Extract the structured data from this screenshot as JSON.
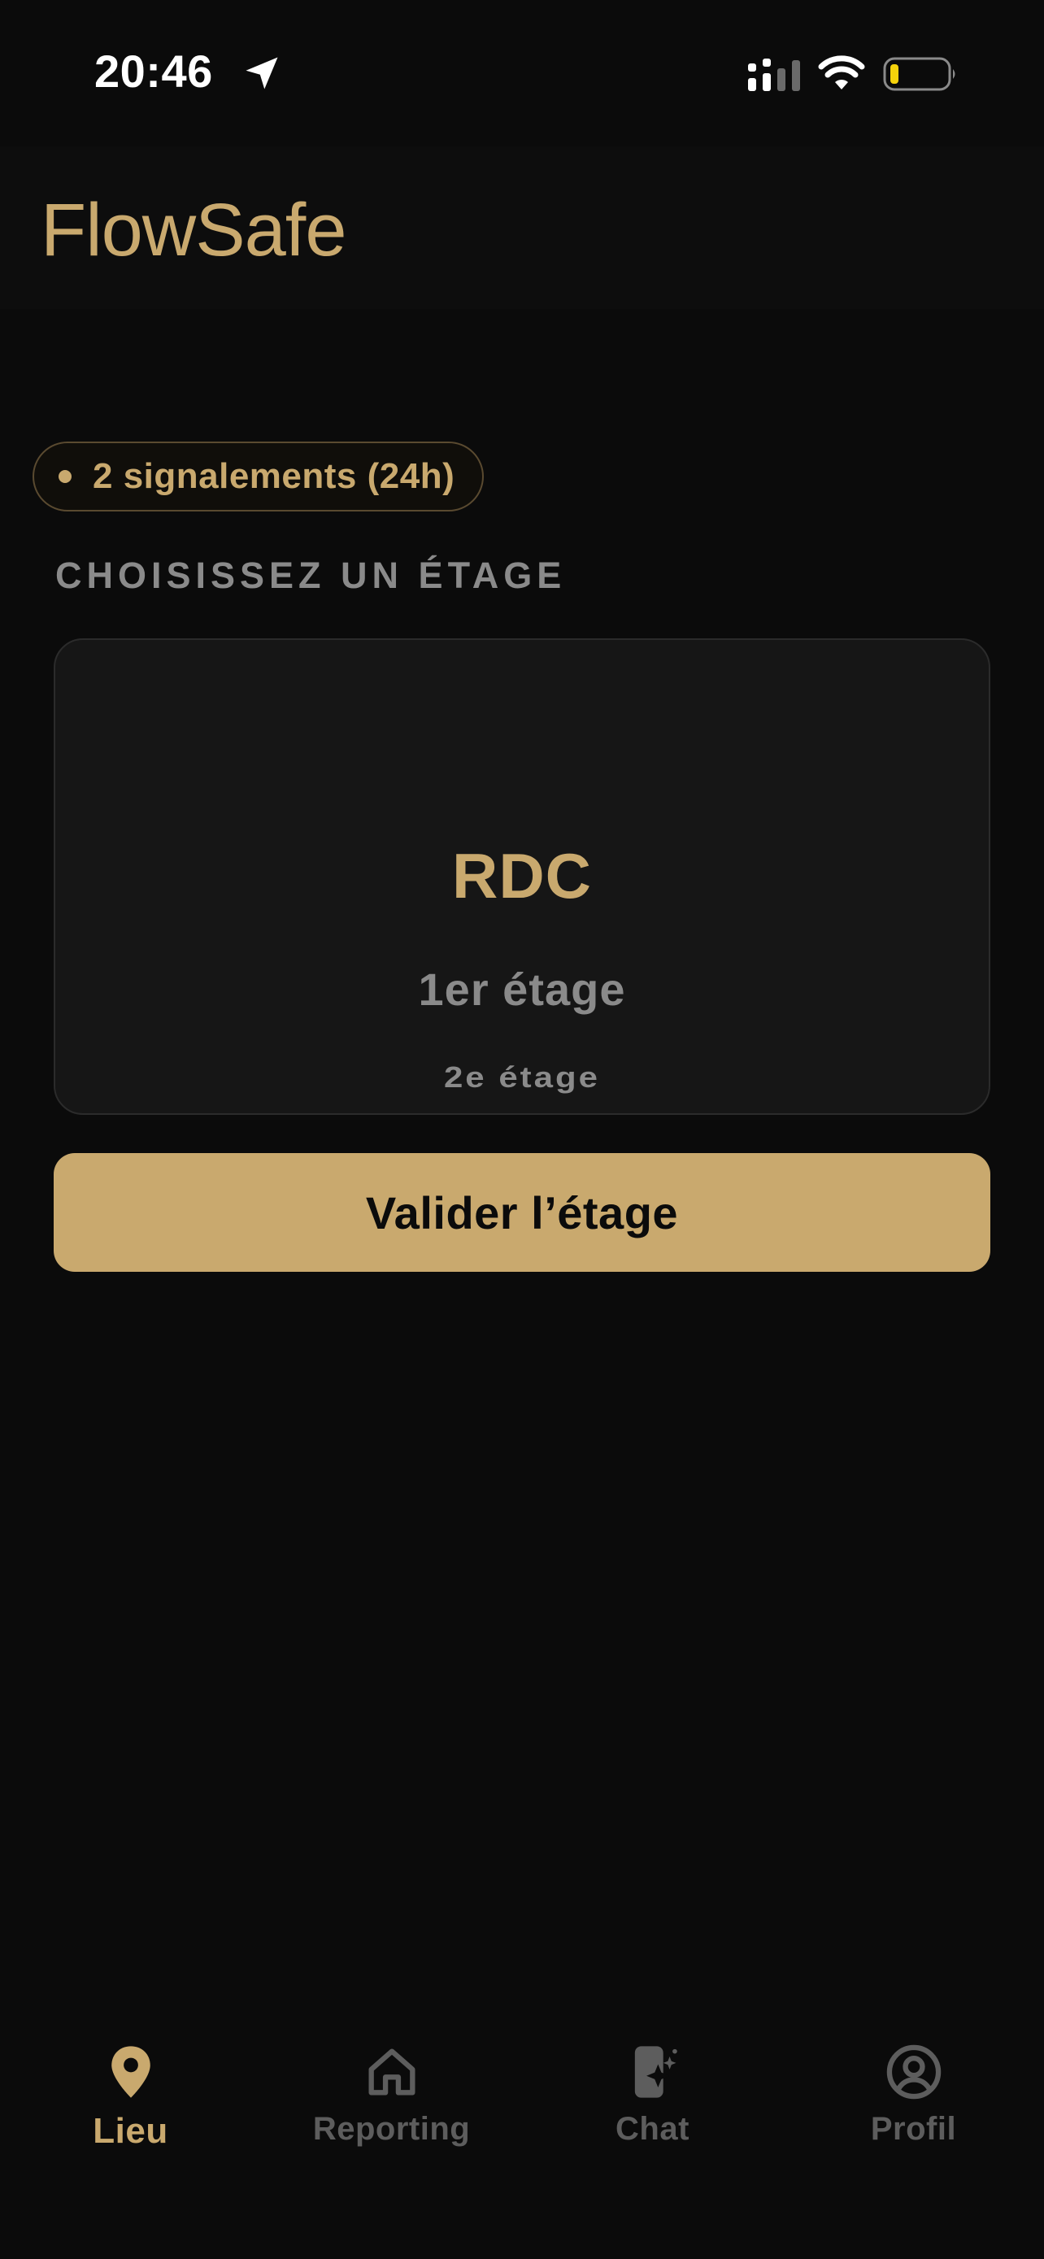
{
  "status_bar": {
    "time": "20:46"
  },
  "header": {
    "app_title": "FlowSafe"
  },
  "reports_badge": {
    "text": "2 signalements (24h)"
  },
  "floor_section": {
    "label": "CHOISISSEZ UN ÉTAGE",
    "options": [
      "RDC",
      "1er étage",
      "2e étage"
    ],
    "selected": "RDC"
  },
  "actions": {
    "validate_label": "Valider l’étage"
  },
  "tab_bar": {
    "tabs": [
      {
        "label": "Lieu",
        "icon": "map-pin-icon",
        "active": true
      },
      {
        "label": "Reporting",
        "icon": "home-icon",
        "active": false
      },
      {
        "label": "Chat",
        "icon": "phone-sparkle-icon",
        "active": false
      },
      {
        "label": "Profil",
        "icon": "user-circle-icon",
        "active": false
      }
    ]
  },
  "colors": {
    "background": "#0b0b0b",
    "accent": "#c9a96e",
    "muted": "#8a8a8a",
    "tab_inactive": "#5d5d5d",
    "card": "#161616"
  }
}
